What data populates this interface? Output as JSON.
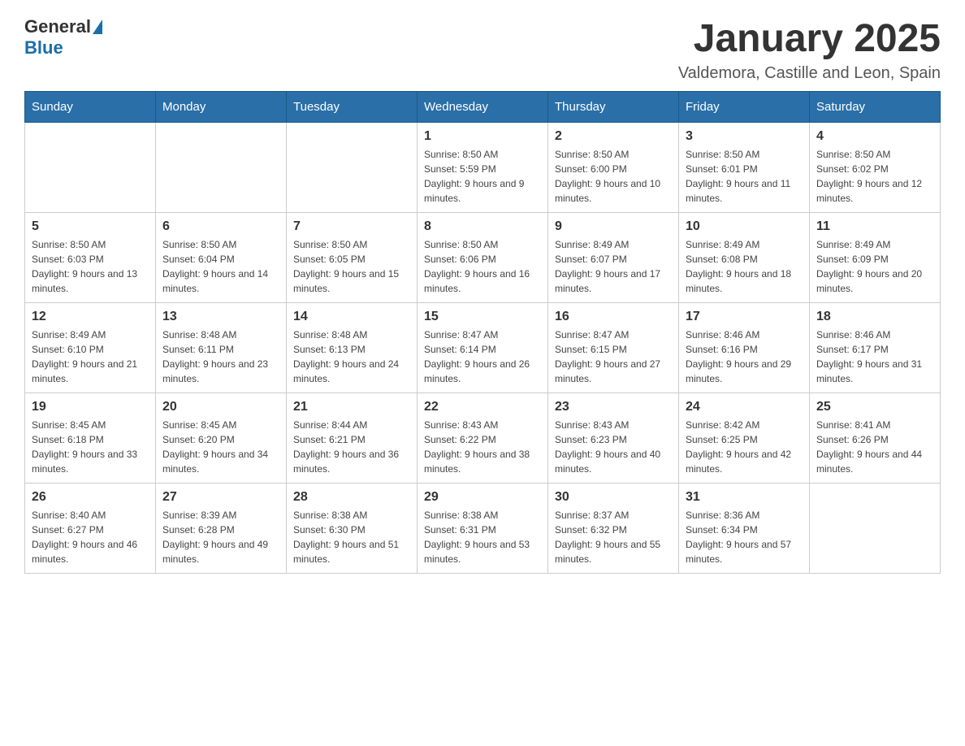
{
  "header": {
    "logo_general": "General",
    "logo_blue": "Blue",
    "month_title": "January 2025",
    "location": "Valdemora, Castille and Leon, Spain"
  },
  "weekdays": [
    "Sunday",
    "Monday",
    "Tuesday",
    "Wednesday",
    "Thursday",
    "Friday",
    "Saturday"
  ],
  "weeks": [
    [
      {
        "day": "",
        "sunrise": "",
        "sunset": "",
        "daylight": ""
      },
      {
        "day": "",
        "sunrise": "",
        "sunset": "",
        "daylight": ""
      },
      {
        "day": "",
        "sunrise": "",
        "sunset": "",
        "daylight": ""
      },
      {
        "day": "1",
        "sunrise": "Sunrise: 8:50 AM",
        "sunset": "Sunset: 5:59 PM",
        "daylight": "Daylight: 9 hours and 9 minutes."
      },
      {
        "day": "2",
        "sunrise": "Sunrise: 8:50 AM",
        "sunset": "Sunset: 6:00 PM",
        "daylight": "Daylight: 9 hours and 10 minutes."
      },
      {
        "day": "3",
        "sunrise": "Sunrise: 8:50 AM",
        "sunset": "Sunset: 6:01 PM",
        "daylight": "Daylight: 9 hours and 11 minutes."
      },
      {
        "day": "4",
        "sunrise": "Sunrise: 8:50 AM",
        "sunset": "Sunset: 6:02 PM",
        "daylight": "Daylight: 9 hours and 12 minutes."
      }
    ],
    [
      {
        "day": "5",
        "sunrise": "Sunrise: 8:50 AM",
        "sunset": "Sunset: 6:03 PM",
        "daylight": "Daylight: 9 hours and 13 minutes."
      },
      {
        "day": "6",
        "sunrise": "Sunrise: 8:50 AM",
        "sunset": "Sunset: 6:04 PM",
        "daylight": "Daylight: 9 hours and 14 minutes."
      },
      {
        "day": "7",
        "sunrise": "Sunrise: 8:50 AM",
        "sunset": "Sunset: 6:05 PM",
        "daylight": "Daylight: 9 hours and 15 minutes."
      },
      {
        "day": "8",
        "sunrise": "Sunrise: 8:50 AM",
        "sunset": "Sunset: 6:06 PM",
        "daylight": "Daylight: 9 hours and 16 minutes."
      },
      {
        "day": "9",
        "sunrise": "Sunrise: 8:49 AM",
        "sunset": "Sunset: 6:07 PM",
        "daylight": "Daylight: 9 hours and 17 minutes."
      },
      {
        "day": "10",
        "sunrise": "Sunrise: 8:49 AM",
        "sunset": "Sunset: 6:08 PM",
        "daylight": "Daylight: 9 hours and 18 minutes."
      },
      {
        "day": "11",
        "sunrise": "Sunrise: 8:49 AM",
        "sunset": "Sunset: 6:09 PM",
        "daylight": "Daylight: 9 hours and 20 minutes."
      }
    ],
    [
      {
        "day": "12",
        "sunrise": "Sunrise: 8:49 AM",
        "sunset": "Sunset: 6:10 PM",
        "daylight": "Daylight: 9 hours and 21 minutes."
      },
      {
        "day": "13",
        "sunrise": "Sunrise: 8:48 AM",
        "sunset": "Sunset: 6:11 PM",
        "daylight": "Daylight: 9 hours and 23 minutes."
      },
      {
        "day": "14",
        "sunrise": "Sunrise: 8:48 AM",
        "sunset": "Sunset: 6:13 PM",
        "daylight": "Daylight: 9 hours and 24 minutes."
      },
      {
        "day": "15",
        "sunrise": "Sunrise: 8:47 AM",
        "sunset": "Sunset: 6:14 PM",
        "daylight": "Daylight: 9 hours and 26 minutes."
      },
      {
        "day": "16",
        "sunrise": "Sunrise: 8:47 AM",
        "sunset": "Sunset: 6:15 PM",
        "daylight": "Daylight: 9 hours and 27 minutes."
      },
      {
        "day": "17",
        "sunrise": "Sunrise: 8:46 AM",
        "sunset": "Sunset: 6:16 PM",
        "daylight": "Daylight: 9 hours and 29 minutes."
      },
      {
        "day": "18",
        "sunrise": "Sunrise: 8:46 AM",
        "sunset": "Sunset: 6:17 PM",
        "daylight": "Daylight: 9 hours and 31 minutes."
      }
    ],
    [
      {
        "day": "19",
        "sunrise": "Sunrise: 8:45 AM",
        "sunset": "Sunset: 6:18 PM",
        "daylight": "Daylight: 9 hours and 33 minutes."
      },
      {
        "day": "20",
        "sunrise": "Sunrise: 8:45 AM",
        "sunset": "Sunset: 6:20 PM",
        "daylight": "Daylight: 9 hours and 34 minutes."
      },
      {
        "day": "21",
        "sunrise": "Sunrise: 8:44 AM",
        "sunset": "Sunset: 6:21 PM",
        "daylight": "Daylight: 9 hours and 36 minutes."
      },
      {
        "day": "22",
        "sunrise": "Sunrise: 8:43 AM",
        "sunset": "Sunset: 6:22 PM",
        "daylight": "Daylight: 9 hours and 38 minutes."
      },
      {
        "day": "23",
        "sunrise": "Sunrise: 8:43 AM",
        "sunset": "Sunset: 6:23 PM",
        "daylight": "Daylight: 9 hours and 40 minutes."
      },
      {
        "day": "24",
        "sunrise": "Sunrise: 8:42 AM",
        "sunset": "Sunset: 6:25 PM",
        "daylight": "Daylight: 9 hours and 42 minutes."
      },
      {
        "day": "25",
        "sunrise": "Sunrise: 8:41 AM",
        "sunset": "Sunset: 6:26 PM",
        "daylight": "Daylight: 9 hours and 44 minutes."
      }
    ],
    [
      {
        "day": "26",
        "sunrise": "Sunrise: 8:40 AM",
        "sunset": "Sunset: 6:27 PM",
        "daylight": "Daylight: 9 hours and 46 minutes."
      },
      {
        "day": "27",
        "sunrise": "Sunrise: 8:39 AM",
        "sunset": "Sunset: 6:28 PM",
        "daylight": "Daylight: 9 hours and 49 minutes."
      },
      {
        "day": "28",
        "sunrise": "Sunrise: 8:38 AM",
        "sunset": "Sunset: 6:30 PM",
        "daylight": "Daylight: 9 hours and 51 minutes."
      },
      {
        "day": "29",
        "sunrise": "Sunrise: 8:38 AM",
        "sunset": "Sunset: 6:31 PM",
        "daylight": "Daylight: 9 hours and 53 minutes."
      },
      {
        "day": "30",
        "sunrise": "Sunrise: 8:37 AM",
        "sunset": "Sunset: 6:32 PM",
        "daylight": "Daylight: 9 hours and 55 minutes."
      },
      {
        "day": "31",
        "sunrise": "Sunrise: 8:36 AM",
        "sunset": "Sunset: 6:34 PM",
        "daylight": "Daylight: 9 hours and 57 minutes."
      },
      {
        "day": "",
        "sunrise": "",
        "sunset": "",
        "daylight": ""
      }
    ]
  ]
}
